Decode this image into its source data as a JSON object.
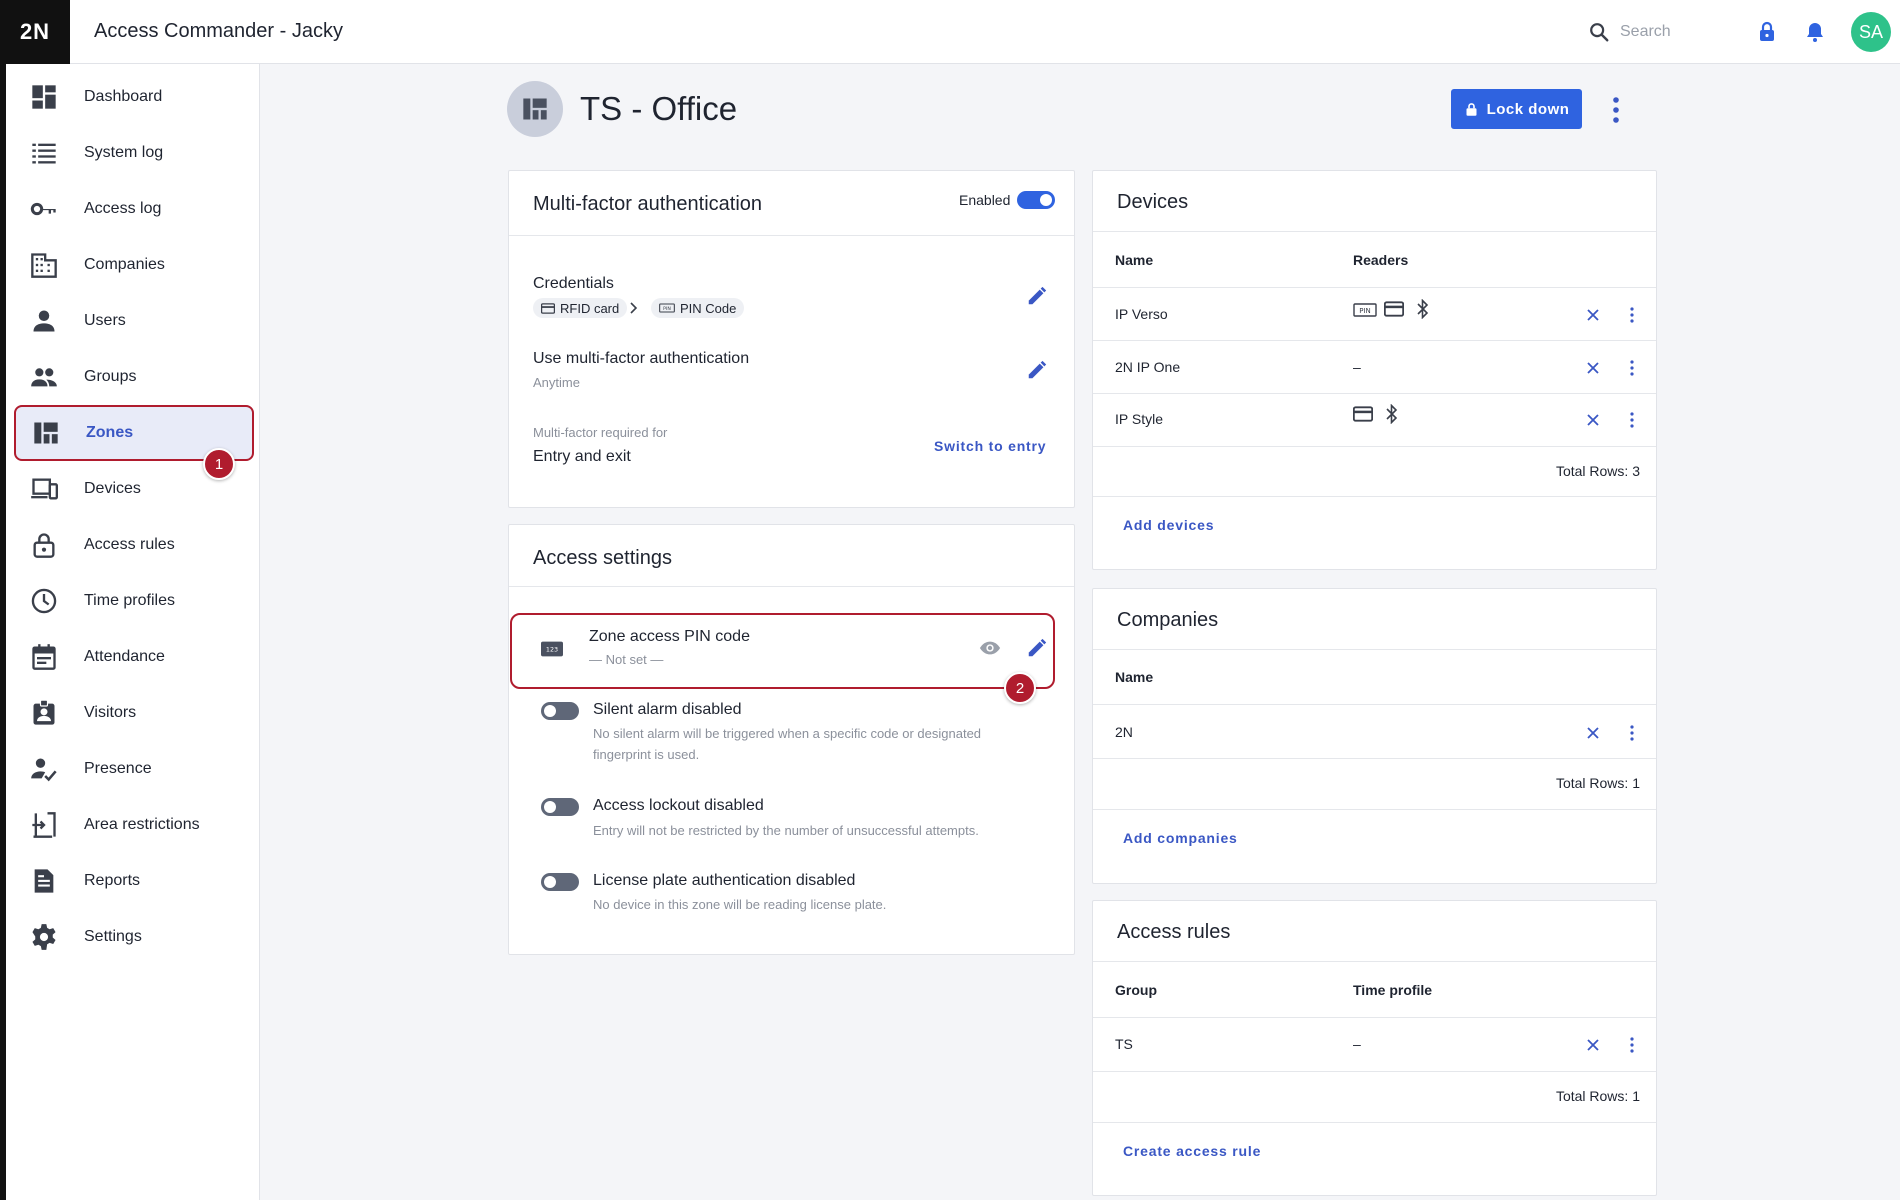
{
  "header": {
    "logo": "2N",
    "title": "Access Commander - Jacky",
    "search_placeholder": "Search",
    "avatar_initials": "SA"
  },
  "sidebar": {
    "items": [
      {
        "label": "Dashboard",
        "icon": "dashboard-icon"
      },
      {
        "label": "System log",
        "icon": "list-icon"
      },
      {
        "label": "Access log",
        "icon": "key-icon"
      },
      {
        "label": "Companies",
        "icon": "building-icon"
      },
      {
        "label": "Users",
        "icon": "user-icon"
      },
      {
        "label": "Groups",
        "icon": "groups-icon"
      },
      {
        "label": "Zones",
        "icon": "zones-icon",
        "active": true
      },
      {
        "label": "Devices",
        "icon": "devices-icon"
      },
      {
        "label": "Access rules",
        "icon": "lock-icon"
      },
      {
        "label": "Time profiles",
        "icon": "clock-icon"
      },
      {
        "label": "Attendance",
        "icon": "calendar-icon"
      },
      {
        "label": "Visitors",
        "icon": "visitor-badge-icon"
      },
      {
        "label": "Presence",
        "icon": "presence-icon"
      },
      {
        "label": "Area restrictions",
        "icon": "area-icon"
      },
      {
        "label": "Reports",
        "icon": "report-icon"
      },
      {
        "label": "Settings",
        "icon": "gear-icon"
      }
    ]
  },
  "annotations": {
    "step1": "1",
    "step2": "2"
  },
  "page": {
    "title": "TS - Office",
    "lock_down_label": "Lock down"
  },
  "mfa": {
    "title": "Multi-factor authentication",
    "enabled_label": "Enabled",
    "enabled": true,
    "credentials_label": "Credentials",
    "chip1": "RFID card",
    "chip2": "PIN Code",
    "use_mfa_label": "Use multi-factor authentication",
    "use_mfa_value": "Anytime",
    "required_for_label": "Multi-factor required for",
    "required_for_value": "Entry and exit",
    "switch_link": "Switch to entry"
  },
  "access_settings": {
    "title": "Access settings",
    "pin_title": "Zone access PIN code",
    "pin_value": "— Not set —",
    "silent_title": "Silent alarm disabled",
    "silent_desc_1": "No silent alarm will be triggered when a specific code or designated",
    "silent_desc_2": "fingerprint is used.",
    "lockout_title": "Access lockout disabled",
    "lockout_desc": "Entry will not be restricted by the number of unsuccessful attempts.",
    "plate_title": "License plate authentication disabled",
    "plate_desc": "No device in this zone will be reading license plate."
  },
  "devices": {
    "title": "Devices",
    "col_name": "Name",
    "col_readers": "Readers",
    "rows": [
      {
        "name": "IP Verso",
        "readers": [
          "pin-icon",
          "card-icon",
          "bluetooth-icon"
        ]
      },
      {
        "name": "2N IP One",
        "readers_text": "–"
      },
      {
        "name": "IP Style",
        "readers": [
          "card-icon",
          "bluetooth-icon"
        ]
      }
    ],
    "total": "Total Rows: 3",
    "add_link": "Add devices"
  },
  "companies": {
    "title": "Companies",
    "col_name": "Name",
    "rows": [
      {
        "name": "2N"
      }
    ],
    "total": "Total Rows: 1",
    "add_link": "Add companies"
  },
  "access_rules": {
    "title": "Access rules",
    "col_group": "Group",
    "col_time": "Time profile",
    "rows": [
      {
        "group": "TS",
        "time": "–"
      }
    ],
    "total": "Total Rows: 1",
    "add_link": "Create access rule"
  },
  "colors": {
    "accent": "#2f63e0",
    "highlight": "#b01c2e",
    "avatar": "#2ec28a"
  }
}
